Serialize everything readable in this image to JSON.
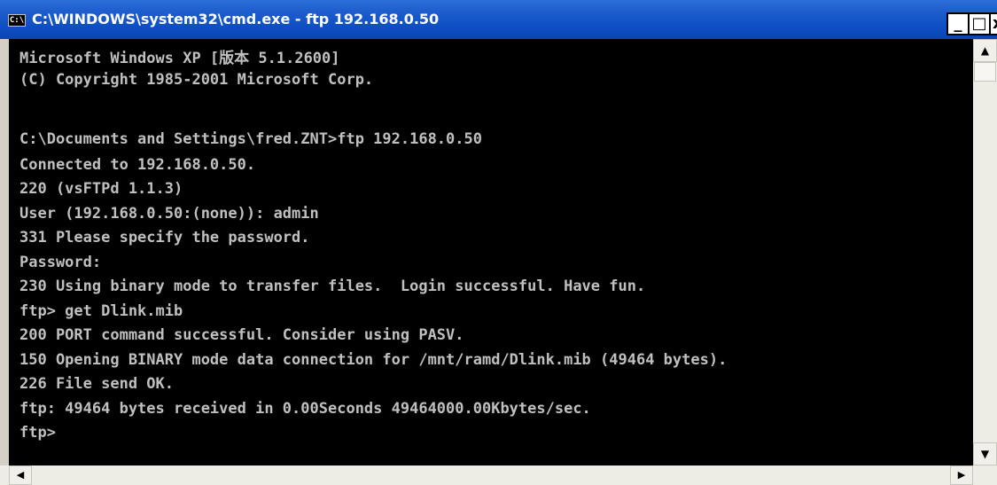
{
  "window": {
    "title": "C:\\WINDOWS\\system32\\cmd.exe - ftp 192.168.0.50",
    "icon_glyph": "C:\\",
    "controls": {
      "minimize": "_",
      "maximize": "□",
      "close": "x"
    }
  },
  "console": {
    "lines": [
      "Microsoft Windows XP [版本 5.1.2600]",
      "(C) Copyright 1985-2001 Microsoft Corp.",
      "",
      "C:\\Documents and Settings\\fred.ZNT>ftp 192.168.0.50",
      "Connected to 192.168.0.50.",
      "220 (vsFTPd 1.1.3)",
      "User (192.168.0.50:(none)): admin",
      "331 Please specify the password.",
      "Password:",
      "230 Using binary mode to transfer files.  Login successful. Have fun.",
      "ftp> get Dlink.mib",
      "200 PORT command successful. Consider using PASV.",
      "150 Opening BINARY mode data connection for /mnt/ramd/Dlink.mib (49464 bytes).",
      "226 File send OK.",
      "ftp: 49464 bytes received in 0.00Seconds 49464000.00Kbytes/sec.",
      "ftp>"
    ]
  },
  "scrollbars": {
    "up_arrow": "▲",
    "down_arrow": "▼",
    "left_arrow": "◀",
    "right_arrow": "▶"
  }
}
